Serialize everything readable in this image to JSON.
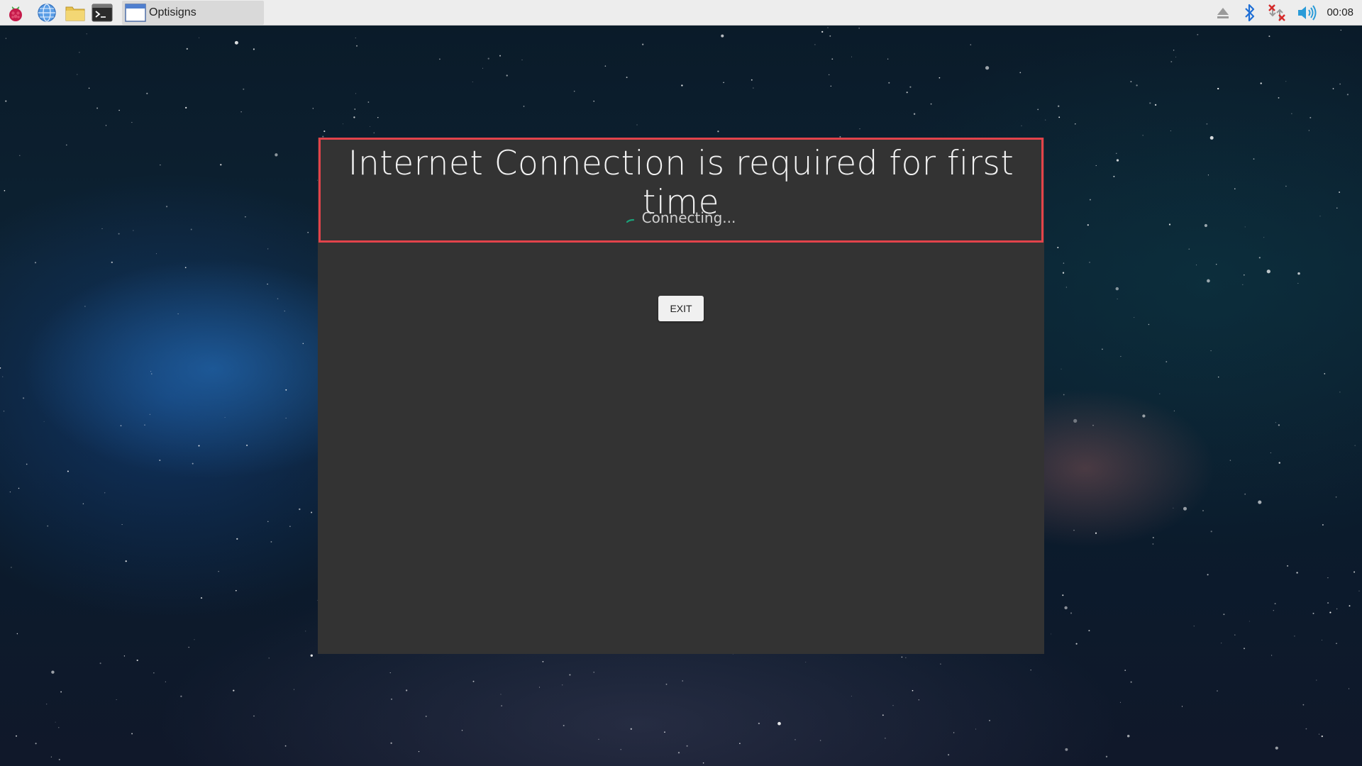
{
  "taskbar": {
    "launchers": [
      {
        "icon": "raspberry-menu-icon"
      },
      {
        "icon": "web-browser-icon"
      },
      {
        "icon": "file-manager-icon"
      },
      {
        "icon": "terminal-icon"
      }
    ],
    "task": {
      "icon": "window-icon",
      "label": "Optisigns"
    },
    "tray": [
      {
        "icon": "eject-icon"
      },
      {
        "icon": "bluetooth-icon"
      },
      {
        "icon": "network-disconnected-icon"
      },
      {
        "icon": "volume-icon"
      }
    ],
    "clock": "00:08"
  },
  "dialog": {
    "title": "Internet Connection is required for first time",
    "status": "Connecting...",
    "exit_label": "EXIT"
  },
  "colors": {
    "taskbar_bg": "#ededed",
    "window_bg": "#333333",
    "highlight_border": "#e2434b",
    "spinner": "#1aa37a",
    "bluetooth": "#1f6fd6",
    "network_error": "#d62828",
    "volume": "#2a9bd8"
  }
}
